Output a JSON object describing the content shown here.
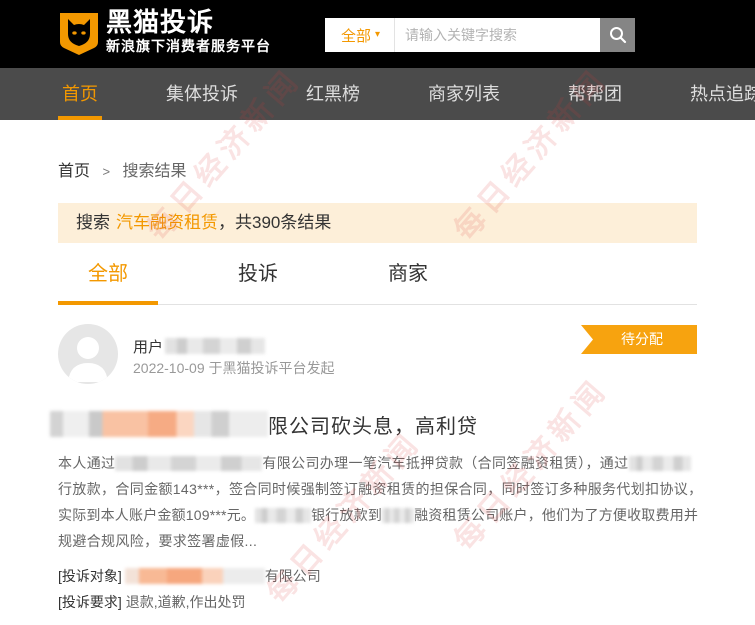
{
  "header": {
    "logo_title": "黑猫投诉",
    "logo_subtitle": "新浪旗下消费者服务平台",
    "logo_icon": "black-cat-logo-icon",
    "search": {
      "scope": "全部",
      "placeholder": "请输入关键字搜索",
      "icon": "search-icon"
    }
  },
  "nav": {
    "items": [
      {
        "label": "首页",
        "active": true
      },
      {
        "label": "集体投诉",
        "active": false
      },
      {
        "label": "红黑榜",
        "active": false
      },
      {
        "label": "商家列表",
        "active": false
      },
      {
        "label": "帮帮团",
        "active": false
      },
      {
        "label": "热点追踪",
        "active": false
      }
    ]
  },
  "breadcrumb": {
    "home": "首页",
    "separator": ">",
    "current": "搜索结果"
  },
  "results_banner": {
    "prefix": "搜索",
    "keyword": "汽车融资租赁",
    "suffix": "，共390条结果"
  },
  "tabs": [
    {
      "label": "全部",
      "active": true
    },
    {
      "label": "投诉",
      "active": false
    },
    {
      "label": "商家",
      "active": false
    }
  ],
  "complaint": {
    "user_prefix": "用户",
    "date_line": "2022-10-09 于黑猫投诉平台发起",
    "status": "待分配",
    "title_tail": "限公司砍头息，高利贷",
    "body_lines": [
      [
        "本人通过",
        "有限公司办理一笔汽车抵押贷款（合同签融资租赁），通过"
      ],
      [
        "行放款，合同金额143***，签合同时候强制签订融资租赁的担保合同，同时签订多种服务代划扣协议，"
      ],
      [
        "实际到本人账户金额109***元。",
        "银行放款到",
        "融资租赁公司账户，他们为了方便收取费用并"
      ],
      [
        "规避合规风险，要求签署虚假..."
      ]
    ],
    "target_label": "[投诉对象]",
    "target_tail": "有限公司",
    "demand_label": "[投诉要求]",
    "demand": "退款,道歉,作出处罚"
  },
  "watermark": {
    "text": "每日经济新闻"
  },
  "colors": {
    "accent": "#f39800",
    "header_bg": "#000000",
    "nav_bg": "#4b4b4b",
    "banner_bg": "#fdefd9",
    "status_badge": "#f7a30f"
  }
}
